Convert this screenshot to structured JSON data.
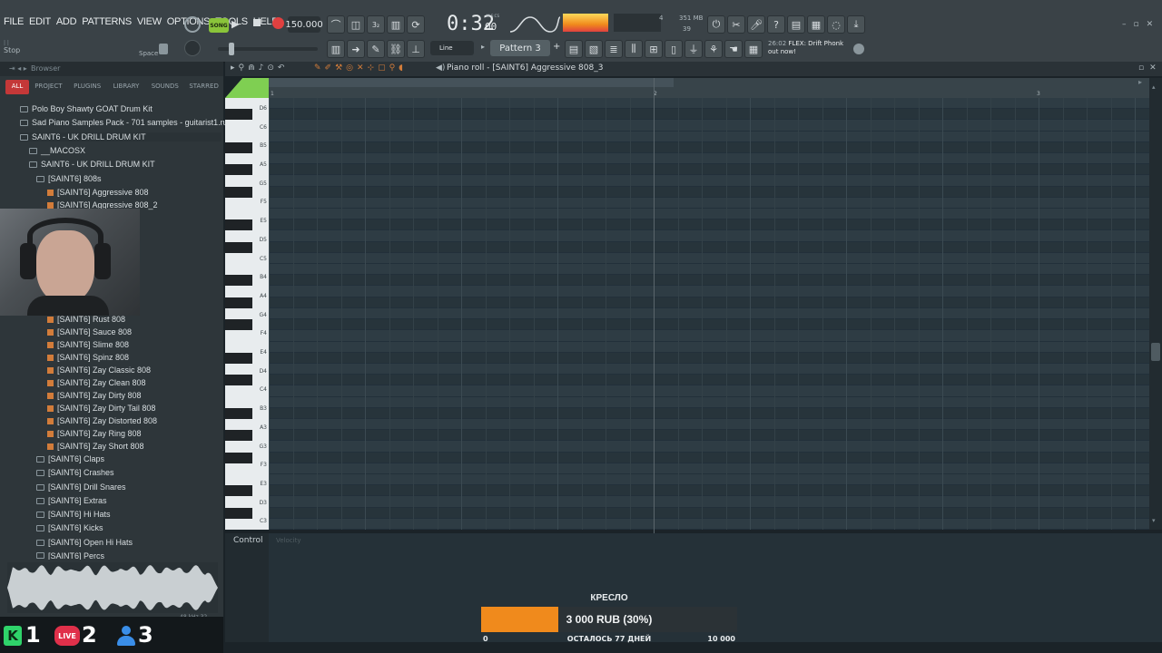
{
  "menu": [
    "FILE",
    "EDIT",
    "ADD",
    "PATTERNS",
    "VIEW",
    "OPTIONS",
    "TOOLS",
    "HELP"
  ],
  "transport": {
    "mode_label": "SONG",
    "tempo": "150.000",
    "time": "0:32",
    "time_small": "00",
    "time_unit": "M:S:CS",
    "memory": "351 MB",
    "voices": "39",
    "cpu": "4"
  },
  "hint": {
    "left": "Stop",
    "right": "Space"
  },
  "snap": "Line",
  "pattern": "Pattern 3",
  "news": {
    "time": "26:02",
    "line1": "FLEX: Drift Phonk",
    "line2": "out now!"
  },
  "browser": {
    "title": "Browser",
    "tabs": [
      "ALL",
      "PROJECT",
      "PLUGINS",
      "LIBRARY",
      "SOUNDS",
      "STARRED"
    ],
    "items": [
      {
        "label": "Polo Boy Shawty GOAT Drum Kit",
        "indent": 0,
        "type": "folder"
      },
      {
        "label": "Sad Piano Samples Pack - 701 samples - guitarist1.ru",
        "indent": 0,
        "type": "folder"
      },
      {
        "label": "SAINT6 - UK DRILL DRUM KIT",
        "indent": 0,
        "type": "folder"
      },
      {
        "label": "__MACOSX",
        "indent": 1,
        "type": "folder"
      },
      {
        "label": "SAINT6 - UK DRILL DRUM KIT",
        "indent": 1,
        "type": "folder"
      },
      {
        "label": "[SAINT6] 808s",
        "indent": 2,
        "type": "folder"
      },
      {
        "label": "[SAINT6] Aggressive 808",
        "indent": 3,
        "type": "file"
      },
      {
        "label": "[SAINT6] Aggressive 808_2",
        "indent": 3,
        "type": "file"
      }
    ],
    "items2": [
      {
        "label": "[SAINT6] Rust 808",
        "type": "file"
      },
      {
        "label": "[SAINT6] Sauce 808",
        "type": "file"
      },
      {
        "label": "[SAINT6] Slime 808",
        "type": "file"
      },
      {
        "label": "[SAINT6] Spinz 808",
        "type": "file"
      },
      {
        "label": "[SAINT6] Zay Classic 808",
        "type": "file"
      },
      {
        "label": "[SAINT6] Zay Clean 808",
        "type": "file"
      },
      {
        "label": "[SAINT6] Zay Dirty 808",
        "type": "file"
      },
      {
        "label": "[SAINT6] Zay Dirty Tail 808",
        "type": "file"
      },
      {
        "label": "[SAINT6] Zay Distorted 808",
        "type": "file"
      },
      {
        "label": "[SAINT6] Zay Ring 808",
        "type": "file"
      },
      {
        "label": "[SAINT6] Zay Short 808",
        "type": "file"
      }
    ],
    "folders2": [
      {
        "label": "[SAINT6] Claps"
      },
      {
        "label": "[SAINT6] Crashes"
      },
      {
        "label": "[SAINT6] Drill Snares"
      },
      {
        "label": "[SAINT6] Extras"
      },
      {
        "label": "[SAINT6] Hi Hats"
      },
      {
        "label": "[SAINT6] Kicks"
      },
      {
        "label": "[SAINT6] Open Hi Hats"
      },
      {
        "label": "[SAINT6] Percs"
      }
    ],
    "sample_info": "48 kHz 32"
  },
  "piano_roll": {
    "title": "Piano roll - [SAINT6] Aggressive 808_3",
    "ruler_marks": [
      "1",
      "2",
      "3"
    ],
    "note_labels": [
      "D6",
      "C6",
      "B5",
      "A5",
      "G5",
      "F5",
      "E5",
      "D5",
      "C5",
      "B4",
      "A4",
      "G4",
      "F4",
      "E4",
      "D4",
      "C4",
      "B3",
      "A3",
      "G3",
      "F3",
      "E3",
      "D3",
      "C3"
    ],
    "control_label": "Control",
    "control_value": "Velocity"
  },
  "overlay": {
    "k_count": "1",
    "live_label": "LIVE",
    "live_count": "2",
    "user_count": "3"
  },
  "goal": {
    "title": "КРЕСЛО",
    "amount": "3 000 RUB (30%)",
    "progress": 0.3,
    "min": "0",
    "remaining": "ОСТАЛОСЬ 77 ДНЕЙ",
    "max": "10 000"
  },
  "colors": {
    "accent": "#f08a1c",
    "record": "#e04040",
    "song_green": "#8ac43a",
    "grid": "#2c3a42"
  }
}
